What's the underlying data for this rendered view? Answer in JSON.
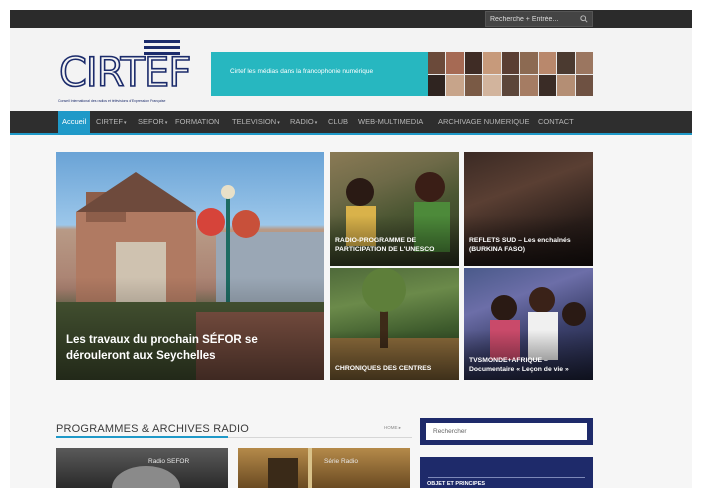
{
  "topbar": {
    "search_placeholder": "Recherche + Entrée..."
  },
  "logo": {
    "text": "CIRTEF",
    "tagline": "Conseil International des radios et télévisions d'Expression Française"
  },
  "banner": {
    "text": "Cirtef  les médias dans la francophonie numérique"
  },
  "nav": {
    "items": [
      {
        "label": "Accueil",
        "caret": ""
      },
      {
        "label": "CIRTEF",
        "caret": "▾"
      },
      {
        "label": "SEFOR",
        "caret": "▾"
      },
      {
        "label": "FORMATION",
        "caret": ""
      },
      {
        "label": "TELEVISION",
        "caret": "▾"
      },
      {
        "label": "RADIO",
        "caret": "▾"
      },
      {
        "label": "CLUB",
        "caret": ""
      },
      {
        "label": "WEB-MULTIMEDIA",
        "caret": ""
      },
      {
        "label": "ARCHIVAGE NUMERIQUE",
        "caret": ""
      },
      {
        "label": "CONTACT",
        "caret": ""
      }
    ]
  },
  "featured": {
    "main": {
      "title": "Les travaux du prochain SÉFOR se dérouleront aux Seychelles"
    },
    "tiles": [
      {
        "title": "RADIO-PROGRAMME DE PARTICIPATION DE L'UNESCO"
      },
      {
        "title": "REFLETS SUD – Les enchaînés (BURKINA FASO)"
      },
      {
        "title": "CHRONIQUES DES CENTRES"
      },
      {
        "title": "TVSMONDE+AFRIQUE – Documentaire « Leçon de vie »"
      }
    ]
  },
  "section": {
    "heading": "PROGRAMMES & ARCHIVES RADIO",
    "breadcrumb": "HOME ▸",
    "thumbs": [
      {
        "caption": "Radio SEFOR"
      },
      {
        "caption": "Série Radio"
      }
    ]
  },
  "sidebar": {
    "search_placeholder": "Rechercher",
    "box_label": "OBJET ET PRINCIPES"
  },
  "colors": {
    "accent": "#1f99c8",
    "navy": "#1e2a6a",
    "teal": "#27b7c0",
    "dark": "#2e2e2e"
  }
}
